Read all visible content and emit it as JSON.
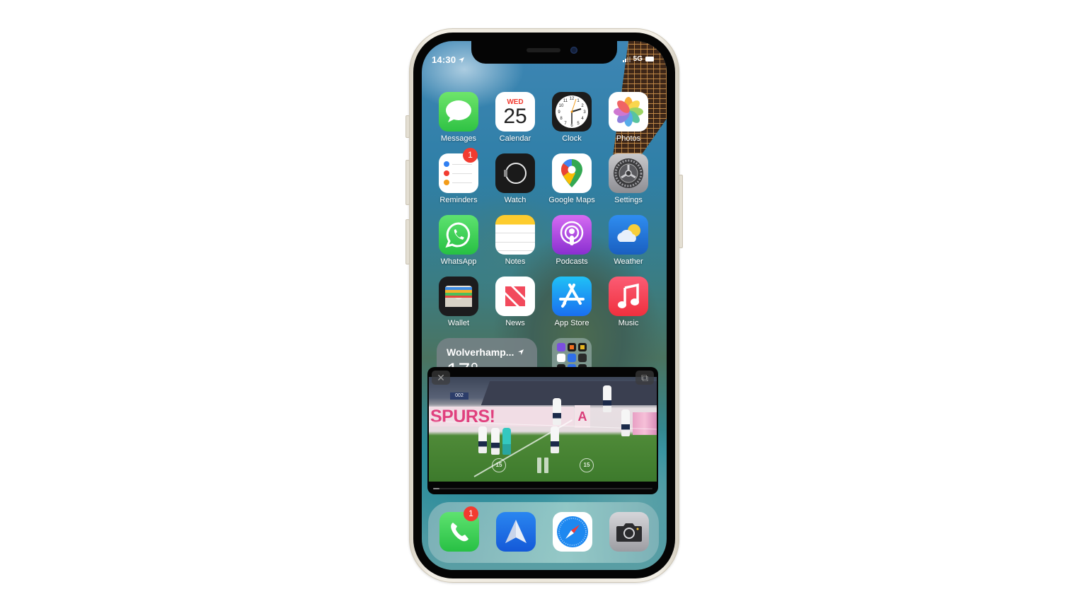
{
  "status_bar": {
    "time": "14:30",
    "location_active": true,
    "network": "5G",
    "signal_bars": 2
  },
  "home_screen": {
    "rows": [
      [
        {
          "name": "Messages",
          "icon": "messages-icon"
        },
        {
          "name": "Calendar",
          "icon": "calendar-icon",
          "day": "WED",
          "date": "25"
        },
        {
          "name": "Clock",
          "icon": "clock-icon"
        },
        {
          "name": "Photos",
          "icon": "photos-icon"
        }
      ],
      [
        {
          "name": "Reminders",
          "icon": "reminders-icon",
          "badge": "1"
        },
        {
          "name": "Watch",
          "icon": "watch-icon"
        },
        {
          "name": "Google Maps",
          "icon": "google-maps-icon"
        },
        {
          "name": "Settings",
          "icon": "settings-icon"
        }
      ],
      [
        {
          "name": "WhatsApp",
          "icon": "whatsapp-icon"
        },
        {
          "name": "Notes",
          "icon": "notes-icon"
        },
        {
          "name": "Podcasts",
          "icon": "podcasts-icon"
        },
        {
          "name": "Weather",
          "icon": "weather-icon"
        }
      ],
      [
        {
          "name": "Wallet",
          "icon": "wallet-icon"
        },
        {
          "name": "News",
          "icon": "news-icon"
        },
        {
          "name": "App Store",
          "icon": "app-store-icon"
        },
        {
          "name": "Music",
          "icon": "music-icon"
        }
      ]
    ],
    "weather_widget": {
      "location": "Wolverhamp...",
      "temperature": "17°"
    },
    "folder": {
      "icon_colors": [
        "#7b4fe0",
        "#1c1c1c",
        "#1c1c1c",
        "#ffffff",
        "#2f6fe8",
        "#2a2a2a",
        "#1c1c1c",
        "#2f6fe8",
        "#1c1c1c"
      ]
    }
  },
  "pip_player": {
    "close_symbol": "✕",
    "return_symbol": "⧉",
    "skip_back_seconds": "15",
    "skip_forward_seconds": "15",
    "banner_text": "SPURS!",
    "banner_text_2": "A",
    "scoreboard": "002",
    "progress_fraction": 0.03
  },
  "dock": {
    "apps": [
      {
        "name": "Phone",
        "icon": "phone-icon",
        "badge": "1"
      },
      {
        "name": "Spark",
        "icon": "spark-mail-icon"
      },
      {
        "name": "Safari",
        "icon": "safari-icon"
      },
      {
        "name": "Camera",
        "icon": "camera-icon"
      }
    ]
  },
  "colors": {
    "badge": "#f23b30",
    "phone_frame": "#ece7dc"
  }
}
